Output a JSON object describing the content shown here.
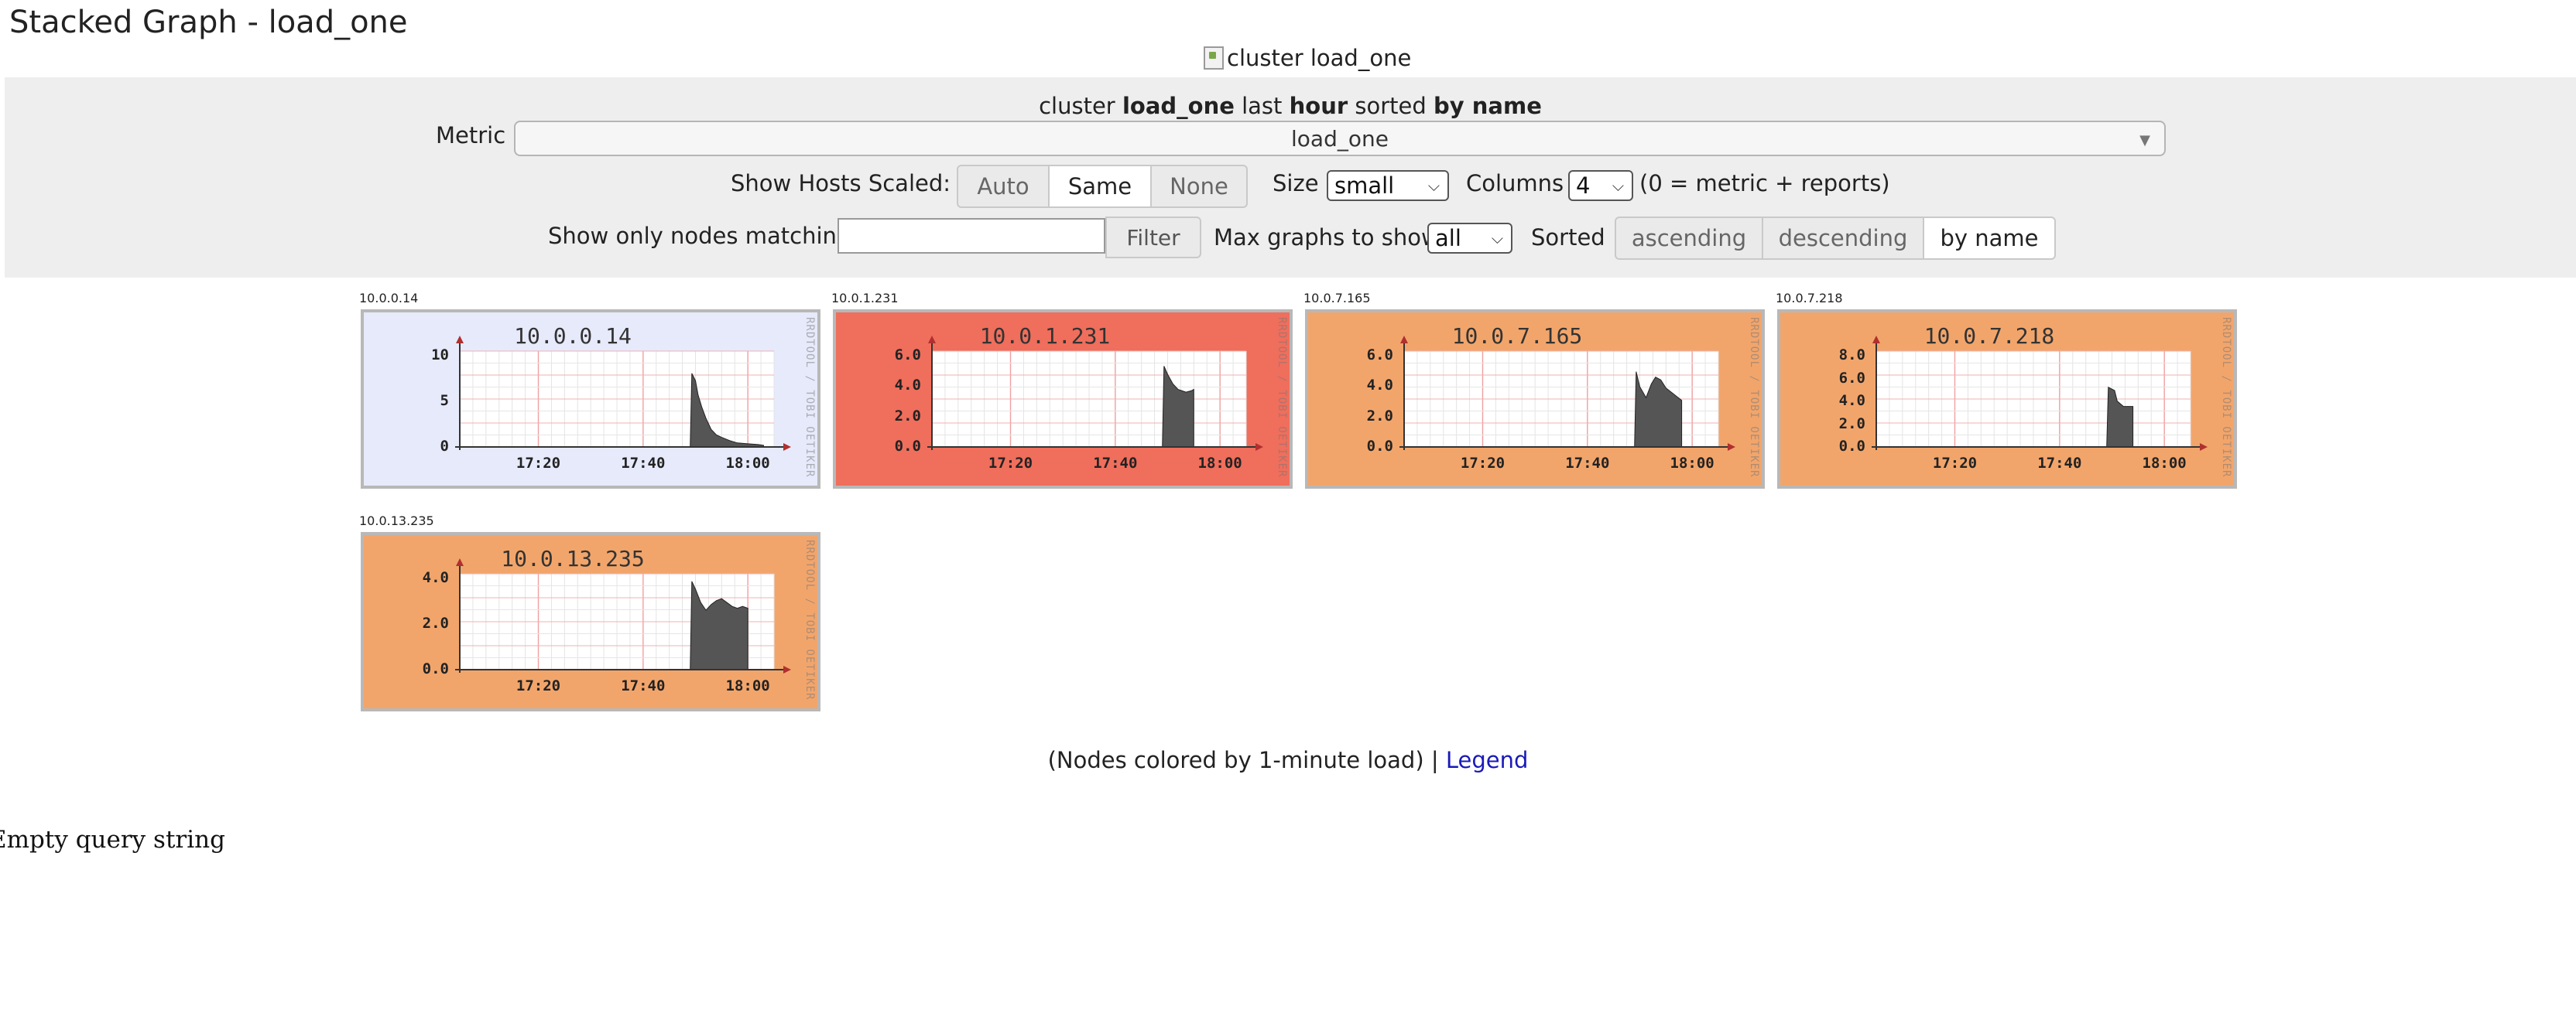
{
  "page": {
    "title": "Stacked Graph - load_one",
    "banner_alt": "cluster load_one"
  },
  "summary": {
    "prefix": "cluster ",
    "metric": "load_one",
    "mid": " last ",
    "range": "hour",
    "mid2": " sorted ",
    "sort": "by name"
  },
  "metric": {
    "label": "Metric",
    "value": "load_one"
  },
  "scaled": {
    "label": "Show Hosts Scaled:",
    "options": [
      "Auto",
      "Same",
      "None"
    ],
    "selected": "Same"
  },
  "size": {
    "label": "Size",
    "value": "small"
  },
  "columns": {
    "label": "Columns",
    "value": "4",
    "hint": "(0 = metric + reports)"
  },
  "filter": {
    "label": "Show only nodes matching",
    "value": "",
    "button": "Filter"
  },
  "maxgraphs": {
    "label": "Max graphs to show",
    "value": "all"
  },
  "sorted": {
    "label": "Sorted",
    "options": [
      "ascending",
      "descending",
      "by name"
    ],
    "selected": "by name"
  },
  "colors": {
    "panel": "#eeeeee",
    "load_low": "#e6eafb",
    "load_high": "#f06e5c",
    "load_mid": "#f2a56b",
    "link": "#1a1ab8"
  },
  "graphs": [
    {
      "host": "10.0.0.14",
      "title": "10.0.0.14",
      "bg": "#e6eafb",
      "yticks": [
        "10",
        "5",
        "0"
      ],
      "ymax": 12,
      "xticks": [
        "17:20",
        "17:40",
        "18:00"
      ],
      "watermark": "RRDTOOL / TOBI OETIKER",
      "series": [
        [
          0,
          0
        ],
        [
          44,
          0
        ],
        [
          44.3,
          9.2
        ],
        [
          45,
          8.3
        ],
        [
          45.5,
          6.5
        ],
        [
          46.2,
          5.0
        ],
        [
          47,
          3.6
        ],
        [
          48,
          2.2
        ],
        [
          49,
          1.5
        ],
        [
          50,
          1.2
        ],
        [
          51.5,
          0.8
        ],
        [
          53,
          0.5
        ],
        [
          55,
          0.4
        ],
        [
          57,
          0.3
        ],
        [
          58,
          0.2
        ]
      ]
    },
    {
      "host": "10.0.1.231",
      "title": "10.0.1.231",
      "bg": "#f06e5c",
      "yticks": [
        "6.0",
        "4.0",
        "2.0",
        "0.0"
      ],
      "ymax": 7,
      "xticks": [
        "17:20",
        "17:40",
        "18:00"
      ],
      "watermark": "RRDTOOL / TOBI OETIKER",
      "series": [
        [
          0,
          0
        ],
        [
          44,
          0
        ],
        [
          44.3,
          5.9
        ],
        [
          45,
          5.3
        ],
        [
          46,
          4.6
        ],
        [
          47,
          4.2
        ],
        [
          48.5,
          4.0
        ],
        [
          49.5,
          4.1
        ],
        [
          50,
          4.2
        ]
      ]
    },
    {
      "host": "10.0.7.165",
      "title": "10.0.7.165",
      "bg": "#f2a56b",
      "yticks": [
        "6.0",
        "4.0",
        "2.0",
        "0.0"
      ],
      "ymax": 7,
      "xticks": [
        "17:20",
        "17:40",
        "18:00"
      ],
      "watermark": "RRDTOOL / TOBI OETIKER",
      "series": [
        [
          0,
          0
        ],
        [
          44,
          0
        ],
        [
          44.3,
          5.5
        ],
        [
          45,
          4.4
        ],
        [
          46.2,
          3.6
        ],
        [
          47.2,
          4.6
        ],
        [
          48,
          5.1
        ],
        [
          49,
          4.9
        ],
        [
          50,
          4.3
        ],
        [
          51,
          4.0
        ],
        [
          52,
          3.7
        ],
        [
          53,
          3.4
        ]
      ]
    },
    {
      "host": "10.0.7.218",
      "title": "10.0.7.218",
      "bg": "#f2a56b",
      "yticks": [
        "8.0",
        "6.0",
        "4.0",
        "2.0",
        "0.0"
      ],
      "ymax": 9,
      "xticks": [
        "17:20",
        "17:40",
        "18:00"
      ],
      "watermark": "RRDTOOL / TOBI OETIKER",
      "series": [
        [
          0,
          0
        ],
        [
          44,
          0
        ],
        [
          44.3,
          5.6
        ],
        [
          45.5,
          5.3
        ],
        [
          46,
          4.3
        ],
        [
          47.2,
          3.8
        ],
        [
          48,
          3.8
        ],
        [
          49,
          3.8
        ]
      ]
    },
    {
      "host": "10.0.13.235",
      "title": "10.0.13.235",
      "bg": "#f2a56b",
      "yticks": [
        "4.0",
        "2.0",
        "0.0"
      ],
      "ymax": 5,
      "xticks": [
        "17:20",
        "17:40",
        "18:00"
      ],
      "watermark": "RRDTOOL / TOBI OETIKER",
      "series": [
        [
          0,
          0
        ],
        [
          44,
          0
        ],
        [
          44.3,
          4.6
        ],
        [
          45,
          4.2
        ],
        [
          46,
          3.5
        ],
        [
          47,
          3.1
        ],
        [
          48,
          3.4
        ],
        [
          49,
          3.6
        ],
        [
          50,
          3.7
        ],
        [
          51,
          3.5
        ],
        [
          52,
          3.3
        ],
        [
          53,
          3.2
        ],
        [
          54,
          3.3
        ],
        [
          55,
          3.2
        ]
      ]
    }
  ],
  "note": {
    "text": "(Nodes colored by 1-minute load) | ",
    "link": "Legend"
  },
  "error": "Empty query string"
}
